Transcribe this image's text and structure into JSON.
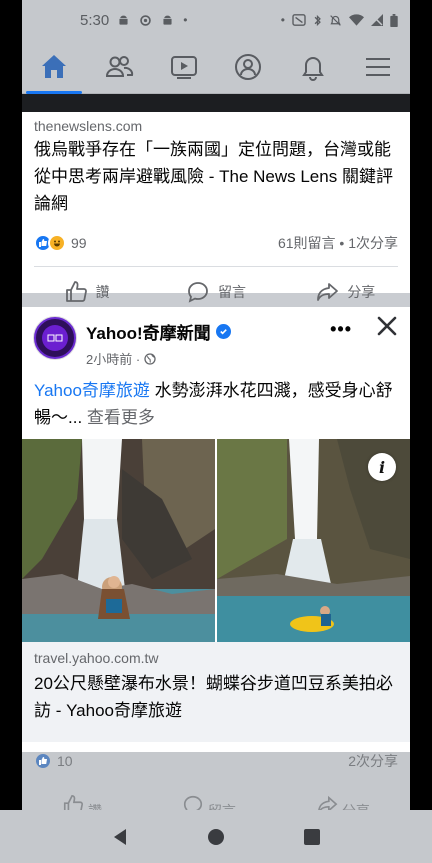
{
  "status_bar": {
    "time": "5:30"
  },
  "nav": {
    "items": [
      {
        "name": "home",
        "active": true
      },
      {
        "name": "friends",
        "active": false
      },
      {
        "name": "watch",
        "active": false
      },
      {
        "name": "profile",
        "active": false
      },
      {
        "name": "notifications",
        "active": false
      },
      {
        "name": "menu",
        "active": false
      }
    ]
  },
  "post1": {
    "domain": "thenewslens.com",
    "title": "俄烏戰爭存在「一族兩國」定位問題，台灣或能從中思考兩岸避戰風險 - The News Lens 關鍵評論網",
    "reaction_count": "99",
    "stats": "61則留言 • 1次分享",
    "actions": {
      "like": "讚",
      "comment": "留言",
      "share": "分享"
    }
  },
  "post2": {
    "page_name": "Yahoo!奇摩新聞",
    "time": "2小時前 ·",
    "body_link": "Yahoo奇摩旅遊",
    "body_text": " 水勢澎湃水花四濺，感受身心舒暢～...",
    "see_more": " 查看更多",
    "link_domain": "travel.yahoo.com.tw",
    "link_title": "20公尺懸壁瀑布水景！蝴蝶谷步道凹豆系美拍必訪 - Yahoo奇摩旅遊",
    "reaction_count": "10",
    "shares": "2次分享",
    "actions": {
      "like": "讚",
      "comment": "留言",
      "share": "分享"
    }
  },
  "colors": {
    "accent": "#1877f2",
    "overlay_gray": "#c5c8cc",
    "secondary_text": "#65676b"
  }
}
